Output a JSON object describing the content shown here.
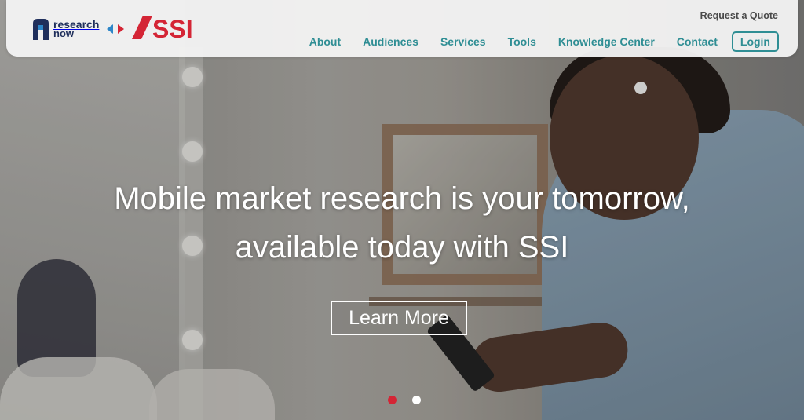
{
  "brand": {
    "research_now_line1": "research",
    "research_now_line2": "now",
    "ssi_name": "SSI"
  },
  "header": {
    "request_quote": "Request a Quote",
    "nav": [
      {
        "label": "About"
      },
      {
        "label": "Audiences"
      },
      {
        "label": "Services"
      },
      {
        "label": "Tools"
      },
      {
        "label": "Knowledge Center"
      },
      {
        "label": "Contact"
      }
    ],
    "login": "Login"
  },
  "hero": {
    "headline_line1": "Mobile market research is your tomorrow,",
    "headline_line2": "available today with SSI",
    "cta": "Learn More",
    "carousel_active_index": 0
  },
  "colors": {
    "nav_teal": "#2f8e94",
    "brand_navy": "#1f2f5c",
    "brand_red": "#d42535",
    "dot_active": "#d42535",
    "dot_inactive": "#ffffff"
  },
  "icons": {
    "logo_mark": "research-now-logo-icon",
    "swap_arrows": "double-arrow-icon",
    "ssi_logo": "ssi-logo-icon"
  }
}
